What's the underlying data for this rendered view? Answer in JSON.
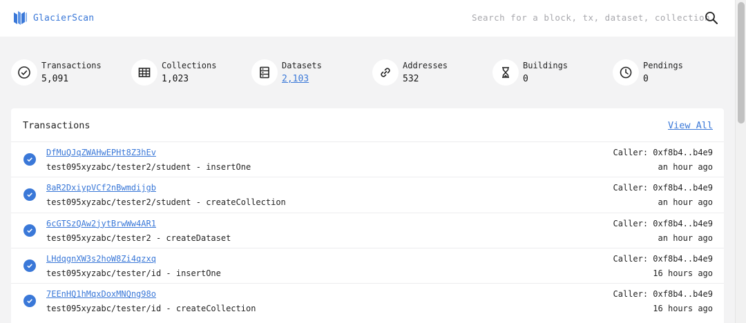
{
  "header": {
    "brand": "GlacierScan",
    "search_placeholder": "Search for a block, tx, dataset, collection"
  },
  "stats": [
    {
      "label": "Transactions",
      "value": "5,091",
      "icon": "check-circle-icon"
    },
    {
      "label": "Collections",
      "value": "1,023",
      "icon": "table-icon"
    },
    {
      "label": "Datasets",
      "value": "2,103",
      "icon": "database-icon"
    },
    {
      "label": "Addresses",
      "value": "532",
      "icon": "link-icon"
    },
    {
      "label": "Buildings",
      "value": "0",
      "icon": "hourglass-icon"
    },
    {
      "label": "Pendings",
      "value": "0",
      "icon": "clock-icon"
    }
  ],
  "transactions": {
    "title": "Transactions",
    "view_all": "View All",
    "rows": [
      {
        "hash": "DfMuQJqZWAHwEPHt8Z3hEv",
        "desc": "test095xyzabc/tester2/student - insertOne",
        "caller": "Caller: 0xf8b4..b4e9",
        "time": "an hour ago"
      },
      {
        "hash": "8aR2DxiypVCf2nBwmdijgb",
        "desc": "test095xyzabc/tester2/student - createCollection",
        "caller": "Caller: 0xf8b4..b4e9",
        "time": "an hour ago"
      },
      {
        "hash": "6cGTSzQAw2jytBrwWw4AR1",
        "desc": "test095xyzabc/tester2 - createDataset",
        "caller": "Caller: 0xf8b4..b4e9",
        "time": "an hour ago"
      },
      {
        "hash": "LHdqgnXW3s2hoW8Zi4qzxq",
        "desc": "test095xyzabc/tester/id - insertOne",
        "caller": "Caller: 0xf8b4..b4e9",
        "time": "16 hours ago"
      },
      {
        "hash": "7EEnHQ1hMqxDoxMNQng98o",
        "desc": "test095xyzabc/tester/id - createCollection",
        "caller": "Caller: 0xf8b4..b4e9",
        "time": "16 hours ago"
      }
    ]
  },
  "colors": {
    "accent": "#3a78d8",
    "background": "#f3f3f4",
    "panel": "#ffffff"
  }
}
